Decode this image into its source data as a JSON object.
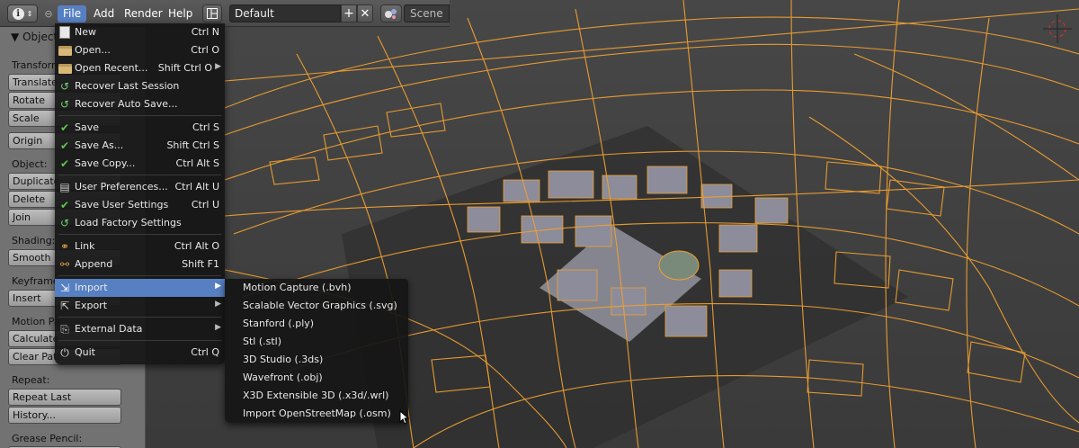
{
  "header": {
    "menus": [
      "File",
      "Add",
      "Render",
      "Help"
    ],
    "layout_name": "Default",
    "scene_name": "Scene"
  },
  "toolshelf": {
    "title": "Object",
    "sections": {
      "transform": "Transform:",
      "object": "Object:",
      "shading": "Shading:",
      "keyframes": "Keyframe",
      "motion_paths": "Motion Pa",
      "repeat": "Repeat:",
      "grease_pencil": "Grease Pencil:"
    },
    "buttons": {
      "translate": "Translate",
      "rotate": "Rotate",
      "scale": "Scale",
      "origin": "Origin",
      "duplicate": "Duplicate",
      "delete": "Delete",
      "join": "Join",
      "smooth": "Smooth",
      "insert": "Insert",
      "calculate": "Calculate",
      "clear_paths": "Clear Path",
      "repeat_last": "Repeat Last",
      "history": "History..."
    }
  },
  "file_menu": {
    "items": [
      {
        "label": "New",
        "shortcut": "Ctrl N",
        "icon": "new-file-icon"
      },
      {
        "label": "Open...",
        "shortcut": "Ctrl O",
        "icon": "folder-icon"
      },
      {
        "label": "Open Recent...",
        "shortcut": "Shift Ctrl O",
        "icon": "folder-recent-icon",
        "submenu": true
      },
      {
        "label": "Recover Last Session",
        "shortcut": "",
        "icon": "recover-icon"
      },
      {
        "label": "Recover Auto Save...",
        "shortcut": "",
        "icon": "recover-auto-icon"
      },
      {
        "label": "Save",
        "shortcut": "Ctrl S",
        "icon": "check-icon"
      },
      {
        "label": "Save As...",
        "shortcut": "Shift Ctrl S",
        "icon": "check-icon"
      },
      {
        "label": "Save Copy...",
        "shortcut": "Ctrl Alt S",
        "icon": "check-icon"
      },
      {
        "label": "User Preferences...",
        "shortcut": "Ctrl Alt U",
        "icon": "preferences-icon"
      },
      {
        "label": "Save User Settings",
        "shortcut": "Ctrl U",
        "icon": "save-settings-icon"
      },
      {
        "label": "Load Factory Settings",
        "shortcut": "",
        "icon": "factory-icon"
      },
      {
        "label": "Link",
        "shortcut": "Ctrl Alt O",
        "icon": "link-icon"
      },
      {
        "label": "Append",
        "shortcut": "Shift F1",
        "icon": "append-icon"
      },
      {
        "label": "Import",
        "shortcut": "",
        "icon": "import-icon",
        "submenu": true
      },
      {
        "label": "Export",
        "shortcut": "",
        "icon": "export-icon",
        "submenu": true
      },
      {
        "label": "External Data",
        "shortcut": "",
        "icon": "external-data-icon",
        "submenu": true
      },
      {
        "label": "Quit",
        "shortcut": "Ctrl Q",
        "icon": "power-icon"
      }
    ]
  },
  "import_menu": {
    "items": [
      "Motion Capture (.bvh)",
      "Scalable Vector Graphics (.svg)",
      "Stanford (.ply)",
      "Stl (.stl)",
      "3D Studio (.3ds)",
      "Wavefront (.obj)",
      "X3D Extensible 3D (.x3d/.wrl)",
      "Import OpenStreetMap (.osm)"
    ]
  },
  "colors": {
    "accent": "#5680c2",
    "wireframe": "#f0a030",
    "viewport_bg": "#3a3a3a"
  }
}
